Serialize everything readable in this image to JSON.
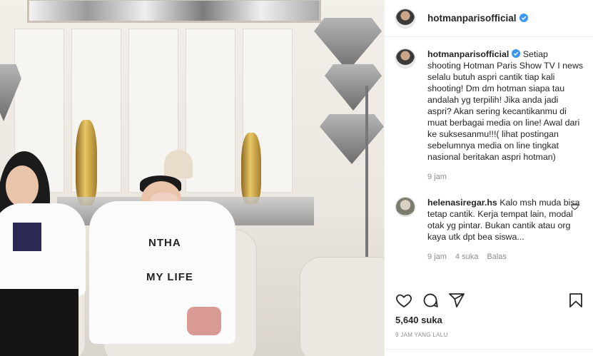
{
  "post": {
    "author": {
      "username": "hotmanparisofficial",
      "verified": true
    },
    "caption": {
      "username": "hotmanparisofficial",
      "text": "Setiap shooting Hotman Paris Show TV I news selalu butuh aspri cantik tiap kali shooting! Dm dm hotman siapa tau andalah yg terpilih! Jika anda jadi aspri? Akan sering kecantikanmu di muat berbagai media on line! Awal dari ke suksesanmu!!!( lihat postingan sebelumnya media on line tingkat nasional beritakan aspri hotman)",
      "time": "9 jam"
    },
    "comments": [
      {
        "username": "helenasiregar.hs",
        "text": "Kalo msh muda bisa tetap cantik. Kerja tempat lain, modal otak yg pintar. Bukan cantik atau org kaya utk dpt bea siswa...",
        "time": "9 jam",
        "likes": "4 suka",
        "reply": "Balas"
      }
    ],
    "likes_label": "5,640 suka",
    "posted_ago": "9 JAM YANG LALU",
    "photo": {
      "shirt_text_1": "NTHA",
      "shirt_text_2": "MY LIFE"
    }
  },
  "colors": {
    "verified_blue": "#3897f0",
    "text_primary": "#262626",
    "text_secondary": "#8e8e8e",
    "border": "#efefef"
  },
  "icons": [
    "heart-icon",
    "comment-icon",
    "share-icon",
    "bookmark-icon",
    "verified-badge-icon",
    "like-comment-icon"
  ]
}
